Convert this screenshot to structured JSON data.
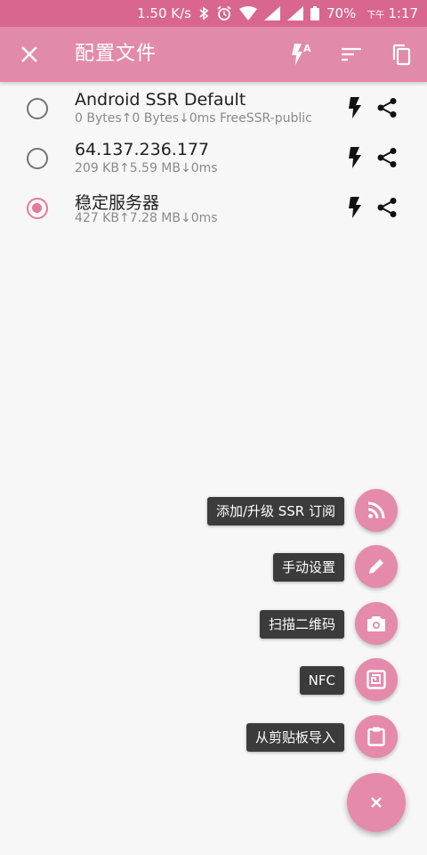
{
  "status_bar": {
    "net_speed": "1.50 K/s",
    "bluetooth_icon": "bluetooth-icon",
    "alarm_icon": "alarm-icon",
    "wifi_icon": "wifi-icon",
    "battery": "70%",
    "am_pm": "下午",
    "time": "1:17"
  },
  "toolbar": {
    "title": "配置文件",
    "close_icon": "close-icon",
    "actions": [
      "flash-auto-icon",
      "sort-icon",
      "copy-icon"
    ]
  },
  "profiles": [
    {
      "name": "Android SSR Default",
      "stats": "0 Bytes↑0 Bytes↓0ms FreeSSR-public",
      "selected": false
    },
    {
      "name": "64.137.236.177",
      "stats": "209 KB↑5.59 MB↓0ms",
      "selected": false
    },
    {
      "name": "稳定服务器",
      "stats": "427 KB↑7.28 MB↓0ms",
      "selected": true
    }
  ],
  "fab_menu": [
    {
      "label": "添加/升级 SSR 订阅",
      "icon": "rss-icon"
    },
    {
      "label": "手动设置",
      "icon": "pencil-icon"
    },
    {
      "label": "扫描二维码",
      "icon": "camera-icon"
    },
    {
      "label": "NFC",
      "icon": "nfc-icon"
    },
    {
      "label": "从剪贴板导入",
      "icon": "clipboard-icon"
    }
  ],
  "fab_main_icon": "close-icon",
  "colors": {
    "status_bar": "#d9668f",
    "toolbar": "#e28aaa",
    "accent": "#e27a9e",
    "fab": "#e58aab",
    "label_bg": "#3b3b3b",
    "background": "#f7f7f7"
  }
}
